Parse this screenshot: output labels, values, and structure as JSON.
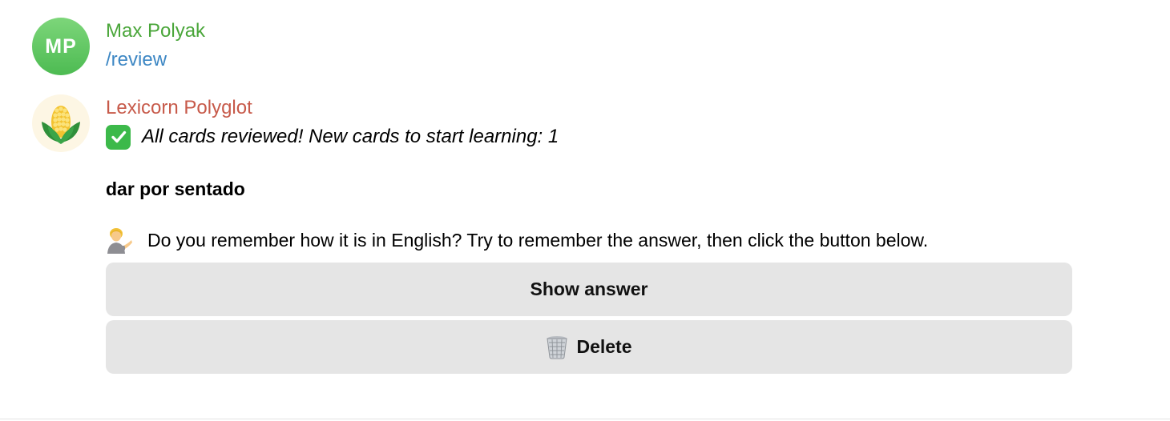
{
  "user_message": {
    "avatar_initials": "MP",
    "avatar_color": "#5cc65a",
    "sender_name": "Max Polyak",
    "sender_color": "#4aa63a",
    "text": "/review",
    "text_color": "#3d87c4"
  },
  "bot_message": {
    "avatar_icon": "corn-icon",
    "sender_name": "Lexicorn Polyglot",
    "sender_color": "#c75a4a",
    "status_icon": "check-mark-icon",
    "status_text": "All cards reviewed! New cards to start learning: 1",
    "word": "dar por sentado",
    "prompt_icon": "person-tipping-hand-icon",
    "prompt_text": "Do you remember how it is in English? Try to remember the answer, then click the button below."
  },
  "buttons": {
    "show_answer_label": "Show answer",
    "delete_icon": "wastebasket-icon",
    "delete_label": "Delete"
  }
}
